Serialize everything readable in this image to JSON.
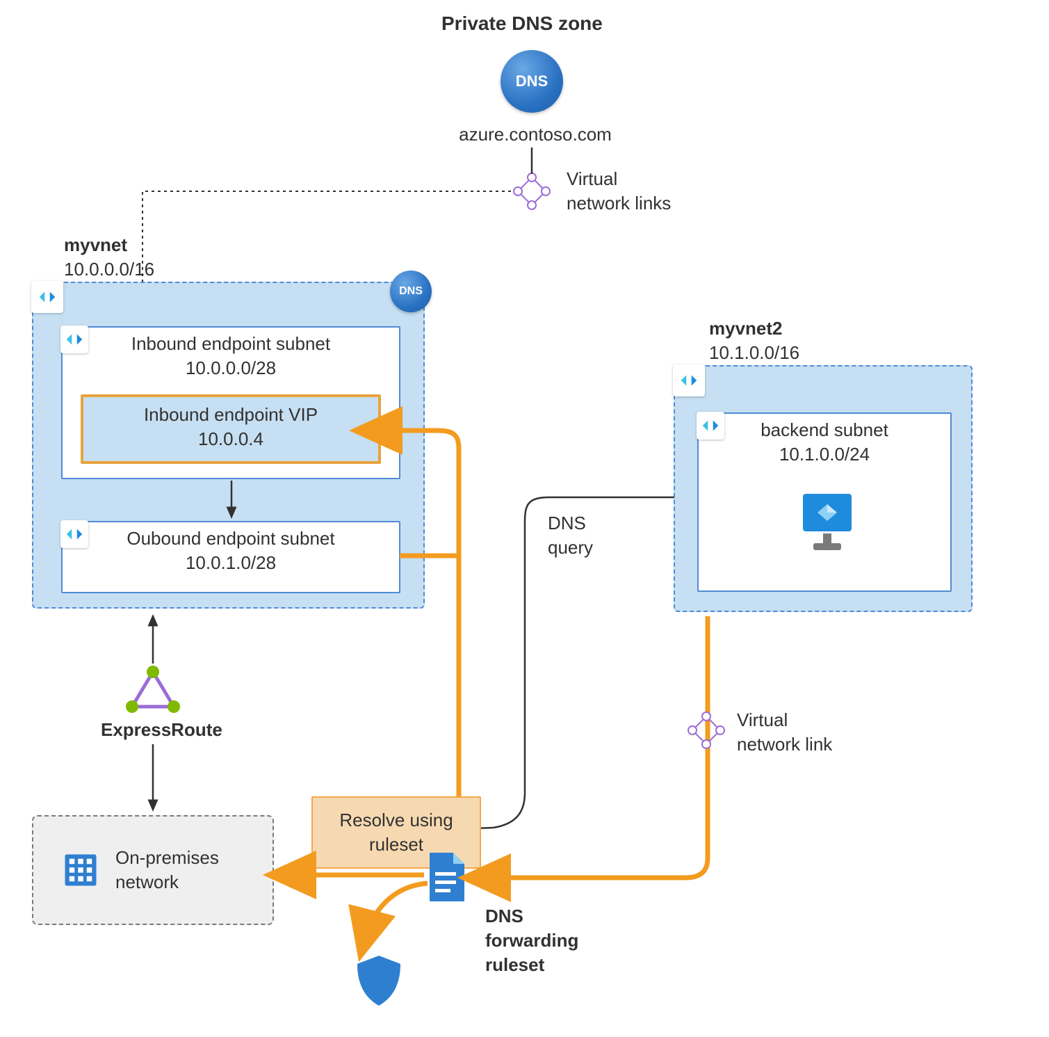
{
  "title": "Private DNS zone",
  "dns_zone": {
    "badge": "DNS",
    "domain": "azure.contoso.com"
  },
  "vnet_links_label": {
    "line1": "Virtual",
    "line2": "network links"
  },
  "myvnet": {
    "name": "myvnet",
    "cidr": "10.0.0.0/16",
    "dns_badge": "DNS",
    "inbound_subnet": {
      "name": "Inbound endpoint subnet",
      "cidr": "10.0.0.0/28"
    },
    "inbound_vip": {
      "name": "Inbound endpoint VIP",
      "ip": "10.0.0.4"
    },
    "outbound_subnet": {
      "name": "Oubound endpoint subnet",
      "cidr": "10.0.1.0/28"
    }
  },
  "myvnet2": {
    "name": "myvnet2",
    "cidr": "10.1.0.0/16",
    "backend_subnet": {
      "name": "backend subnet",
      "cidr": "10.1.0.0/24"
    }
  },
  "dns_query_label": {
    "line1": "DNS",
    "line2": "query"
  },
  "expressroute_label": "ExpressRoute",
  "onprem": {
    "line1": "On-premises",
    "line2": "network"
  },
  "ruleset_box": {
    "line1": "Resolve using",
    "line2": "ruleset"
  },
  "vnet_link2_label": {
    "line1": "Virtual",
    "line2": "network link"
  },
  "ruleset_label": {
    "line1": "DNS",
    "line2": "forwarding",
    "line3": "ruleset"
  }
}
